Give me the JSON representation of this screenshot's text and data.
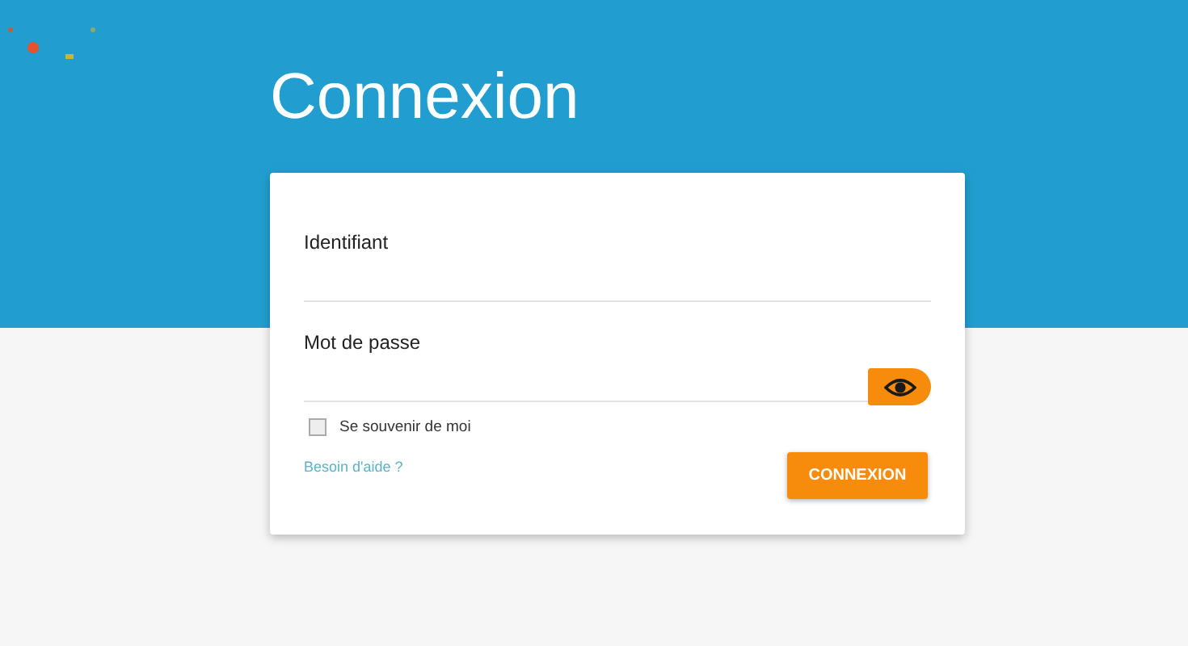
{
  "title": "Connexion",
  "fields": [
    {
      "label": "Identifiant",
      "kind": "text"
    },
    {
      "label": "Mot de passe",
      "kind": "password"
    }
  ],
  "remember": {
    "label": "Se souvenir de moi",
    "checked": false
  },
  "help_link": "Besoin d'aide ?",
  "submit": "CONNEXION"
}
